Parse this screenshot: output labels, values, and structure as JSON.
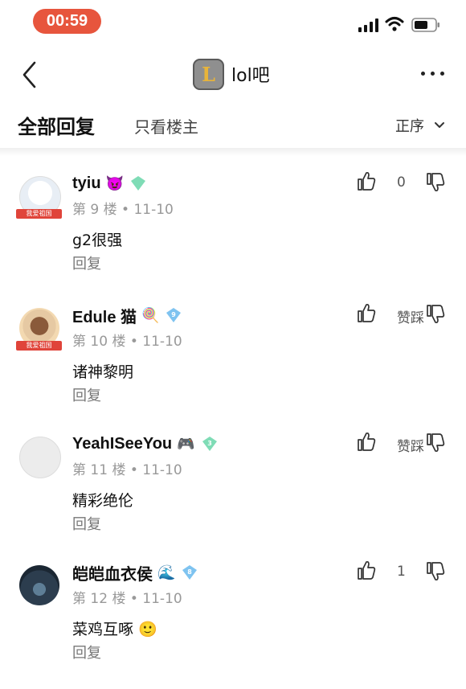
{
  "status_bar": {
    "time": "00:59"
  },
  "nav": {
    "forum_name": "lol吧",
    "logo_letter": "L"
  },
  "tabs": {
    "all_replies": "全部回复",
    "op_only": "只看楼主",
    "sort": "正序"
  },
  "replies": [
    {
      "username": "tyiu",
      "emoji": "😈",
      "level": "",
      "floor": "第 9 楼",
      "date": "11-10",
      "content": "g2很强",
      "reply_label": "回复",
      "likes": "0",
      "badge": "我爱祖国",
      "gem_color": "#7fdcb6"
    },
    {
      "username": "Edule 猫",
      "emoji": "🍭",
      "level": "9",
      "floor": "第 10 楼",
      "date": "11-10",
      "content": "诸神黎明",
      "reply_label": "回复",
      "likes": "赞踩",
      "badge": "我爱祖国",
      "gem_color": "#7ec3f0"
    },
    {
      "username": "YeahISeeYou",
      "emoji": "🎮",
      "level": "3",
      "floor": "第 11 楼",
      "date": "11-10",
      "content": "精彩绝伦",
      "reply_label": "回复",
      "likes": "赞踩",
      "badge": "",
      "gem_color": "#7fdcb6"
    },
    {
      "username": "皑皑血衣侯",
      "emoji": "🌊",
      "level": "8",
      "floor": "第 12 楼",
      "date": "11-10",
      "content": "菜鸡互啄 🙂",
      "reply_label": "回复",
      "likes": "1",
      "badge": "",
      "gem_color": "#7ec3f0"
    }
  ],
  "icons": {
    "back": "chevron-left-icon",
    "more": "more-dots-icon",
    "sort": "chevron-down-icon",
    "like": "thumbs-up-icon",
    "dislike": "thumbs-down-icon",
    "gem": "level-gem-icon"
  },
  "colors": {
    "accent": "#e7553d",
    "badge_red": "#e0443a",
    "meta_gray": "#999999"
  }
}
